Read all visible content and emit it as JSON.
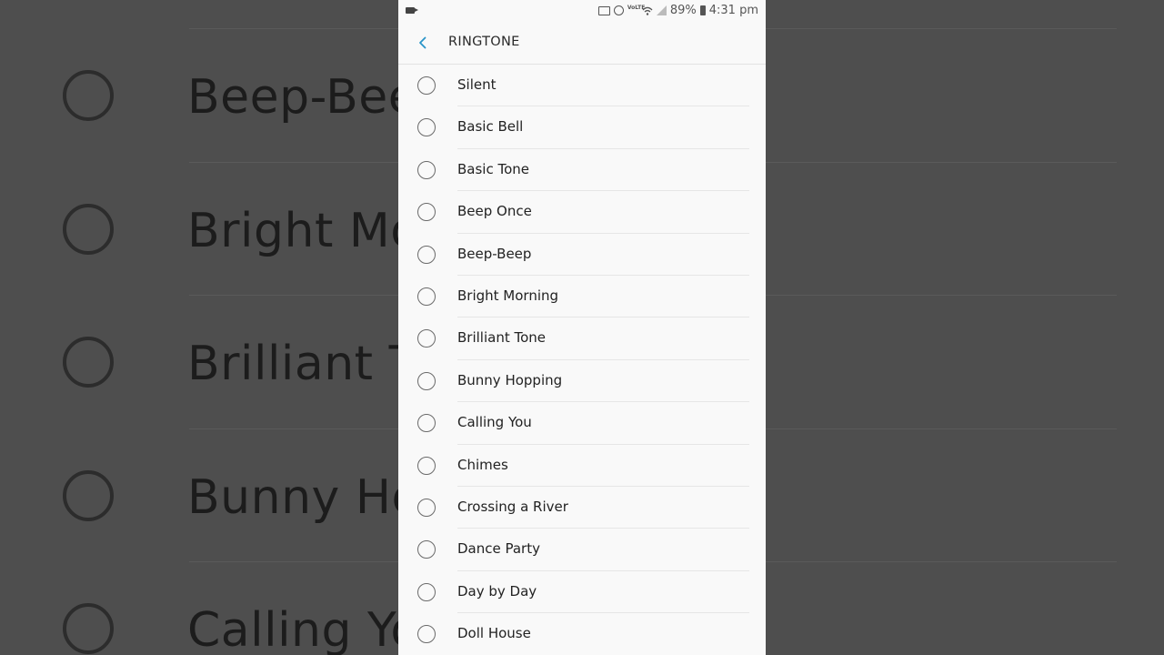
{
  "status_bar": {
    "battery": "89%",
    "time": "4:31 pm",
    "volte_label": "VoLTE",
    "icons": [
      "video-icon",
      "cast-icon",
      "alarm-icon",
      "volte-icon",
      "wifi-icon",
      "signal-icon",
      "battery-icon"
    ]
  },
  "header": {
    "title": "RINGTONE",
    "back_icon": "chevron-left-icon",
    "accent_color": "#2a94c8"
  },
  "ringtones": [
    {
      "label": "Silent",
      "selected": false
    },
    {
      "label": "Basic Bell",
      "selected": false
    },
    {
      "label": "Basic Tone",
      "selected": false
    },
    {
      "label": "Beep Once",
      "selected": false
    },
    {
      "label": "Beep-Beep",
      "selected": false
    },
    {
      "label": "Bright Morning",
      "selected": false
    },
    {
      "label": "Brilliant Tone",
      "selected": false
    },
    {
      "label": "Bunny Hopping",
      "selected": false
    },
    {
      "label": "Calling You",
      "selected": false
    },
    {
      "label": "Chimes",
      "selected": false
    },
    {
      "label": "Crossing a River",
      "selected": false
    },
    {
      "label": "Dance Party",
      "selected": false
    },
    {
      "label": "Day by Day",
      "selected": false
    },
    {
      "label": "Doll House",
      "selected": false
    }
  ],
  "background": {
    "labels": [
      "Beep-Beep",
      "Bright Mo",
      "Brilliant T",
      "Bunny Hop",
      "Calling Yo"
    ]
  }
}
